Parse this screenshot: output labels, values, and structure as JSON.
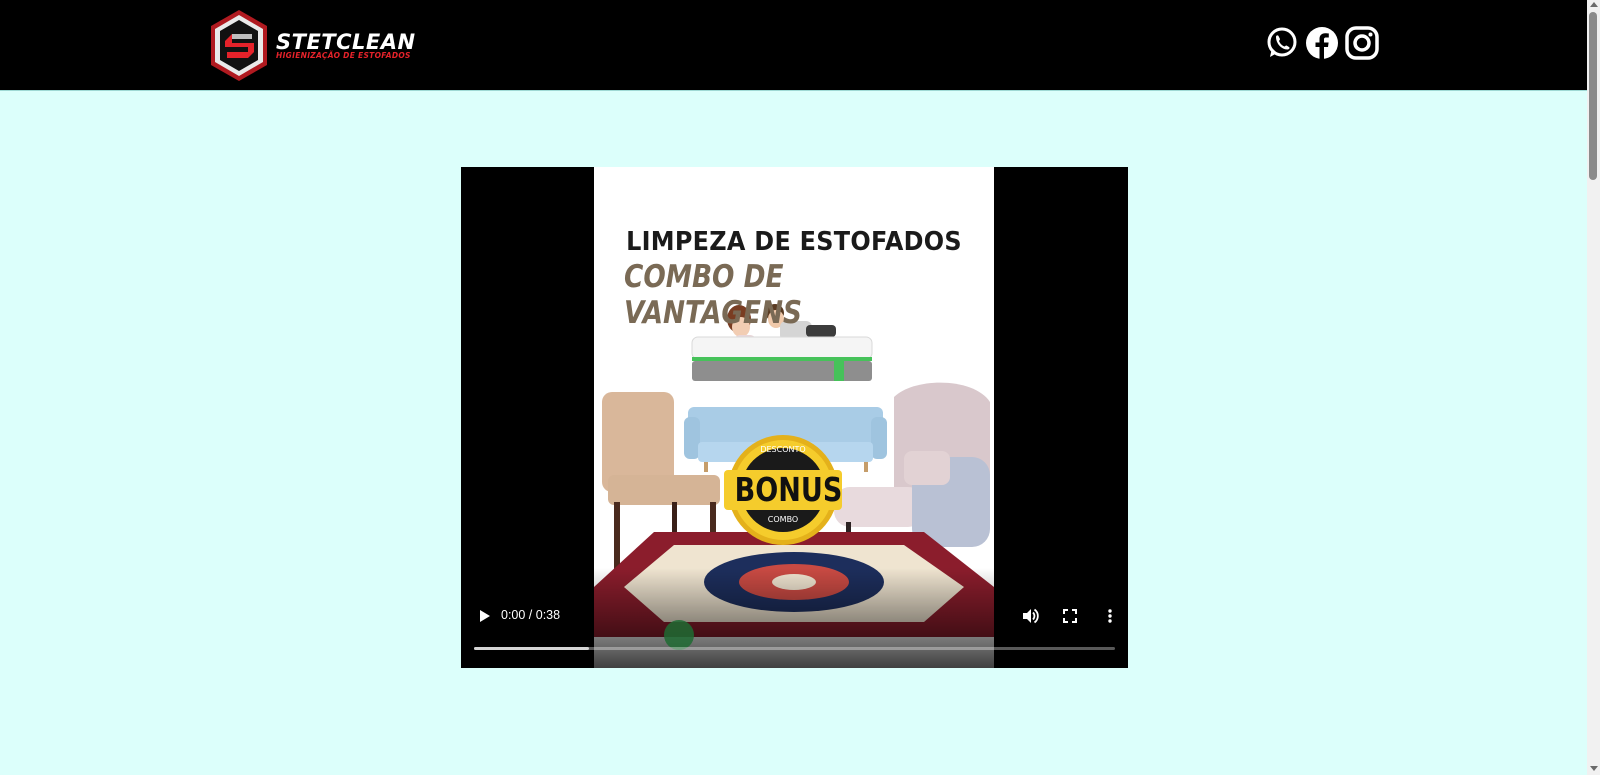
{
  "header": {
    "brand_name": "STETCLEAN",
    "tagline": "HIGIENIZAÇÃO DE ESTOFADOS",
    "social_icons": [
      "whatsapp-icon",
      "facebook-icon",
      "instagram-icon"
    ]
  },
  "video": {
    "poster_title": "LIMPEZA DE ESTOFADOS",
    "poster_subtitle": "COMBO DE VANTAGENS",
    "badge_top": "DESCONTO",
    "badge_main": "BONUS",
    "badge_bottom": "COMBO",
    "time_display": "0:00 / 0:38",
    "buffered_percent": 18
  },
  "colors": {
    "header_bg": "#000000",
    "page_bg": "#dcfffb",
    "brand_red": "#e5222a"
  }
}
